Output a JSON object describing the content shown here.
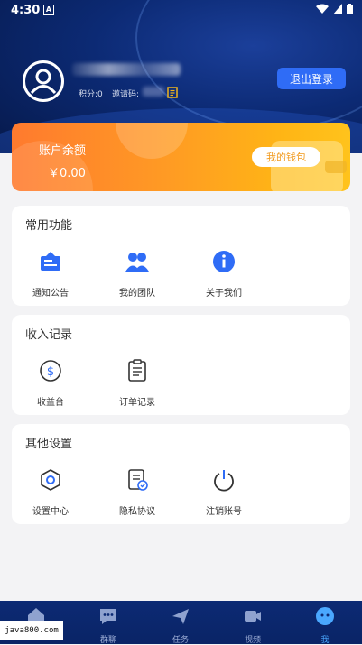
{
  "status_bar": {
    "time": "4:30",
    "a_icon": "A"
  },
  "profile": {
    "points_label": "积分:0",
    "invite_label": "邀请码:",
    "logout_label": "退出登录"
  },
  "balance": {
    "title": "账户余额",
    "amount": "￥0.00",
    "wallet_label": "我的钱包"
  },
  "sections": {
    "common": {
      "title": "常用功能",
      "items": [
        {
          "label": "通知公告",
          "icon": "announcement-icon"
        },
        {
          "label": "我的团队",
          "icon": "team-icon"
        },
        {
          "label": "关于我们",
          "icon": "info-icon"
        }
      ]
    },
    "income": {
      "title": "收入记录",
      "items": [
        {
          "label": "收益台",
          "icon": "dollar-coin-icon"
        },
        {
          "label": "订单记录",
          "icon": "clipboard-icon"
        }
      ]
    },
    "other": {
      "title": "其他设置",
      "items": [
        {
          "label": "设置中心",
          "icon": "hexagon-settings-icon"
        },
        {
          "label": "隐私协议",
          "icon": "privacy-document-icon"
        },
        {
          "label": "注销账号",
          "icon": "power-icon"
        }
      ]
    }
  },
  "tabbar": {
    "items": [
      {
        "label": "",
        "icon": "home-icon"
      },
      {
        "label": "群聊",
        "icon": "chat-icon"
      },
      {
        "label": "任务",
        "icon": "send-icon"
      },
      {
        "label": "视频",
        "icon": "video-icon"
      },
      {
        "label": "我",
        "icon": "me-chat-icon",
        "active": true
      }
    ]
  },
  "watermark": "java800.com",
  "colors": {
    "header_bg": "#0c2a74",
    "accent_blue": "#2f6cf6",
    "balance_orange": "#ff9a24",
    "wallet_text": "#f29a1d",
    "active_tab": "#4aa8ff"
  }
}
